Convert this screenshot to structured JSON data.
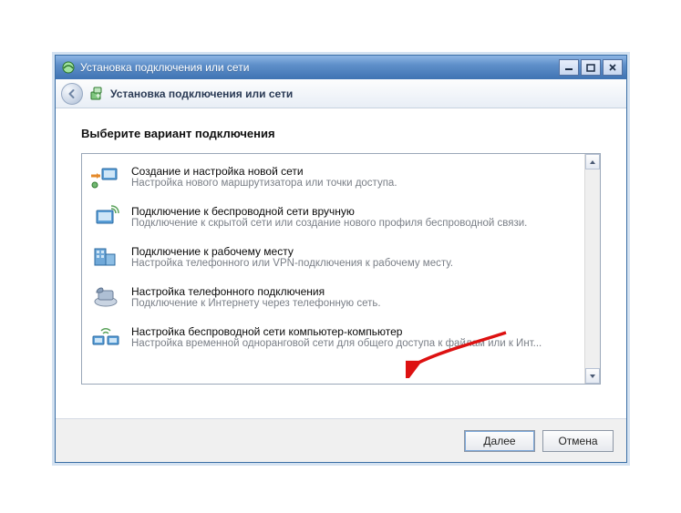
{
  "window": {
    "title": "Установка подключения или сети",
    "header_title": "Установка подключения или сети",
    "heading": "Выберите вариант подключения"
  },
  "options": [
    {
      "title": "Создание и настройка новой сети",
      "desc": "Настройка нового маршрутизатора или точки доступа.",
      "icon": "new-network-icon"
    },
    {
      "title": "Подключение к беспроводной сети вручную",
      "desc": "Подключение к скрытой сети или создание нового профиля беспроводной связи.",
      "icon": "manual-wireless-icon"
    },
    {
      "title": "Подключение к рабочему месту",
      "desc": "Настройка телефонного или VPN-подключения к рабочему месту.",
      "icon": "workplace-icon"
    },
    {
      "title": "Настройка телефонного подключения",
      "desc": "Подключение к Интернету через телефонную сеть.",
      "icon": "dialup-icon"
    },
    {
      "title": "Настройка беспроводной сети компьютер-компьютер",
      "desc": "Настройка временной одноранговой сети для общего доступа к файлам или к Инт...",
      "icon": "adhoc-icon"
    }
  ],
  "buttons": {
    "next": "Далее",
    "cancel": "Отмена"
  },
  "colors": {
    "accent": "#3f73b3"
  }
}
